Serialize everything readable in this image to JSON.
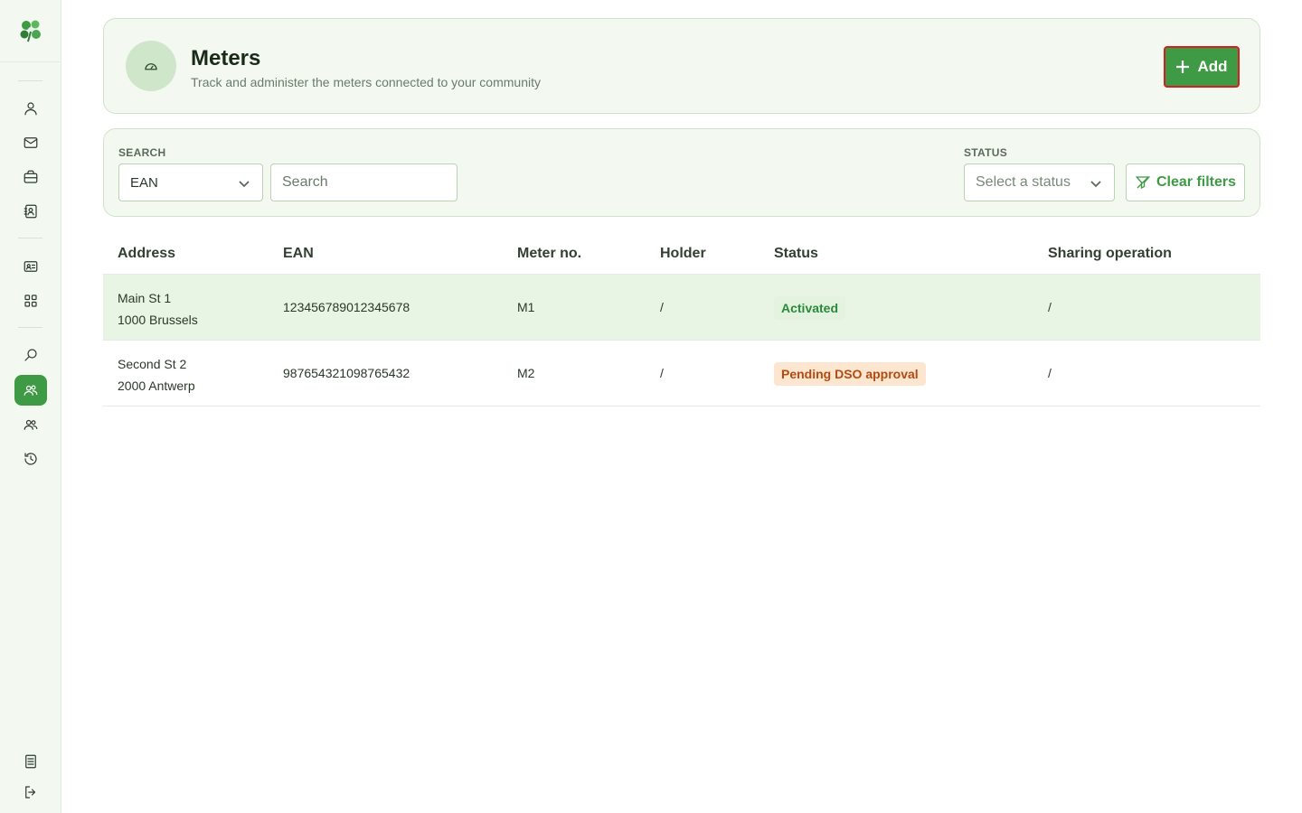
{
  "sidebar": {
    "items": [
      {
        "icon": "user-icon"
      },
      {
        "icon": "mail-icon"
      },
      {
        "icon": "briefcase-icon"
      },
      {
        "icon": "contact-book-icon"
      },
      {
        "icon": "id-card-icon"
      },
      {
        "icon": "grid-icon"
      },
      {
        "icon": "search-icon"
      },
      {
        "icon": "community-icon",
        "active": true
      },
      {
        "icon": "users-icon"
      },
      {
        "icon": "history-icon"
      },
      {
        "icon": "document-icon"
      },
      {
        "icon": "logout-icon"
      }
    ]
  },
  "header": {
    "title": "Meters",
    "subtitle": "Track and administer the meters connected to your community",
    "add_label": "Add"
  },
  "filters": {
    "search_label": "SEARCH",
    "search_field_value": "EAN",
    "search_placeholder": "Search",
    "status_label": "STATUS",
    "status_placeholder": "Select a status",
    "clear_label": "Clear filters"
  },
  "table": {
    "columns": [
      "Address",
      "EAN",
      "Meter no.",
      "Holder",
      "Status",
      "Sharing operation"
    ],
    "rows": [
      {
        "address_line1": "Main St 1",
        "address_line2": "1000 Brussels",
        "ean": "123456789012345678",
        "meter_no": "M1",
        "holder": "/",
        "status": "Activated",
        "sharing": "/"
      },
      {
        "address_line1": "Second St 2",
        "address_line2": "2000 Antwerp",
        "ean": "987654321098765432",
        "meter_no": "M2",
        "holder": "/",
        "status": "Pending DSO approval",
        "sharing": "/"
      }
    ]
  },
  "colors": {
    "accent": "#3f9a45",
    "activated_bg": "#e3f3e0",
    "pending_bg": "#fde6cf"
  }
}
